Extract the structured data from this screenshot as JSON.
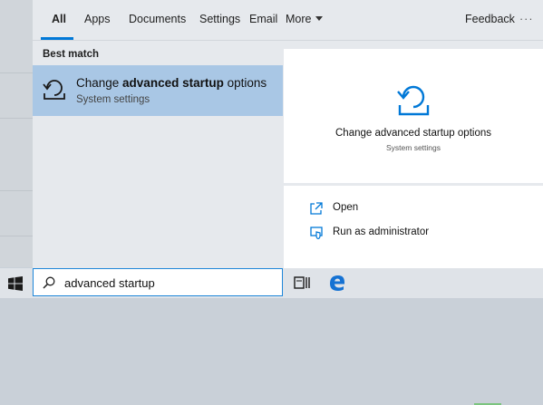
{
  "tabs": {
    "all": "All",
    "apps": "Apps",
    "documents": "Documents",
    "settings": "Settings",
    "email": "Email",
    "more": "More",
    "feedback": "Feedback",
    "ellipsis": "···"
  },
  "best_match": {
    "section_label": "Best match",
    "title_prefix": "Change ",
    "title_bold": "advanced startup",
    "title_suffix": " options",
    "subtitle": "System settings",
    "icon": "recovery-startup-icon"
  },
  "preview": {
    "title": "Change advanced startup options",
    "subtitle": "System settings",
    "icon": "recovery-startup-icon"
  },
  "actions": [
    {
      "label": "Open",
      "icon": "open-icon"
    },
    {
      "label": "Run as administrator",
      "icon": "run-as-admin-icon"
    }
  ],
  "taskbar": {
    "search_value": "advanced startup",
    "start_icon": "windows-logo-icon",
    "search_icon": "search-icon",
    "task_view_icon": "task-view-icon",
    "browser_icon": "edge-icon"
  },
  "colors": {
    "accent": "#0078d7",
    "selection": "#a9c7e5"
  }
}
